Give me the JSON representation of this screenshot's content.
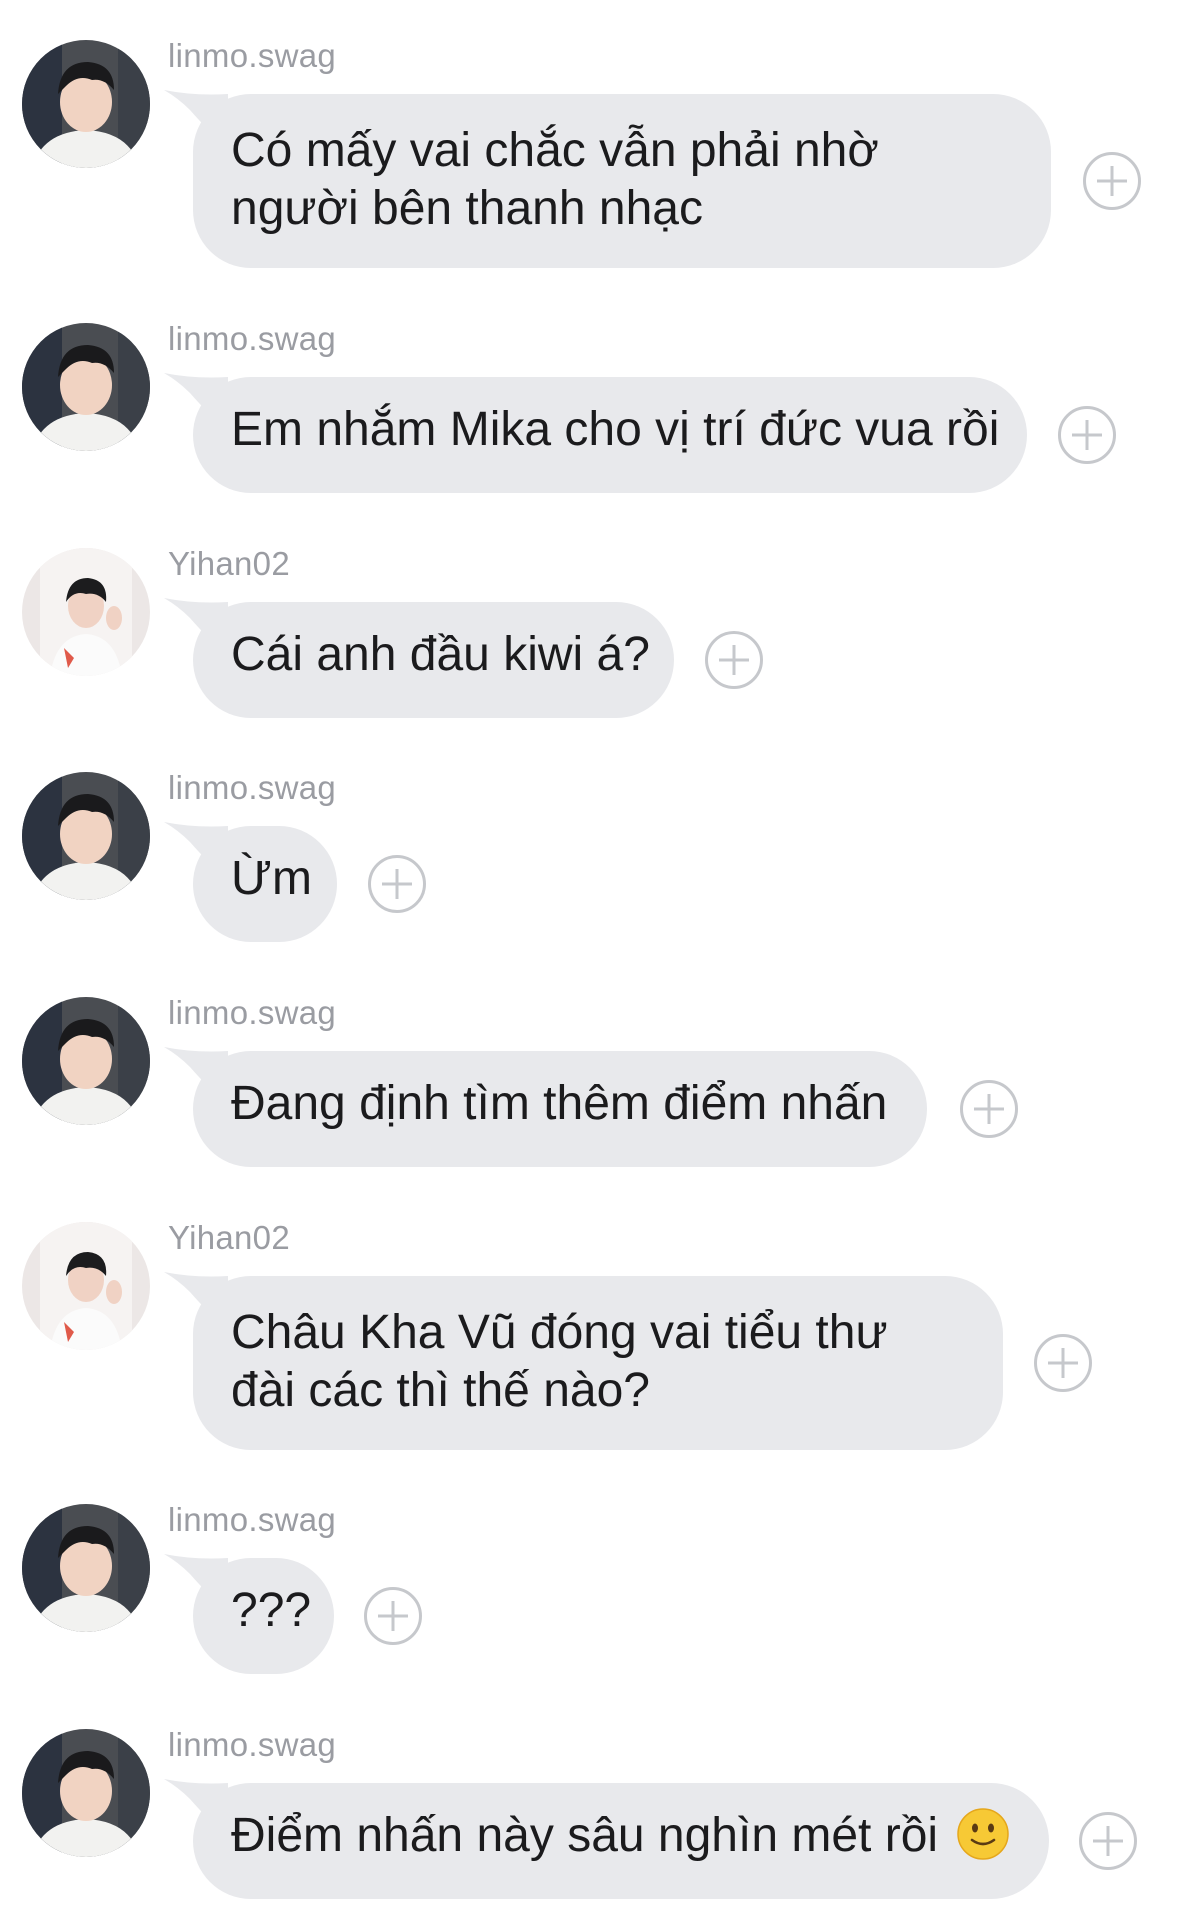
{
  "messages": [
    {
      "user": "linmo.swag",
      "text": "Có mấy vai chắc vẫn phải nhờ người bên thanh nhạc",
      "avatar": "linmo-avatar",
      "multiline": true
    },
    {
      "user": "linmo.swag",
      "text": "Em nhắm Mika cho vị trí đức vua rồi",
      "avatar": "linmo-avatar"
    },
    {
      "user": "Yihan02",
      "text": "Cái anh đầu kiwi á?",
      "avatar": "yihan-avatar"
    },
    {
      "user": "linmo.swag",
      "text": "Ừm",
      "avatar": "linmo-avatar"
    },
    {
      "user": "linmo.swag",
      "text": "Đang định tìm thêm điểm nhấn",
      "avatar": "linmo-avatar"
    },
    {
      "user": "Yihan02",
      "text": "Châu Kha Vũ đóng vai tiểu thư đài các thì thế nào?",
      "avatar": "yihan-avatar",
      "multiline": true
    },
    {
      "user": "linmo.swag",
      "text": "???",
      "avatar": "linmo-avatar"
    },
    {
      "user": "linmo.swag",
      "text": "Điểm nhấn này sâu nghìn mét rồi",
      "avatar": "linmo-avatar",
      "emoji": "slightly-smiling-face-icon"
    }
  ],
  "icons": {
    "react": "add-reaction-icon"
  },
  "colors": {
    "bubble": "#e8e9ec",
    "username": "#9a9ca2",
    "text": "#1b1b1d",
    "react_border": "#c6c8cc"
  }
}
